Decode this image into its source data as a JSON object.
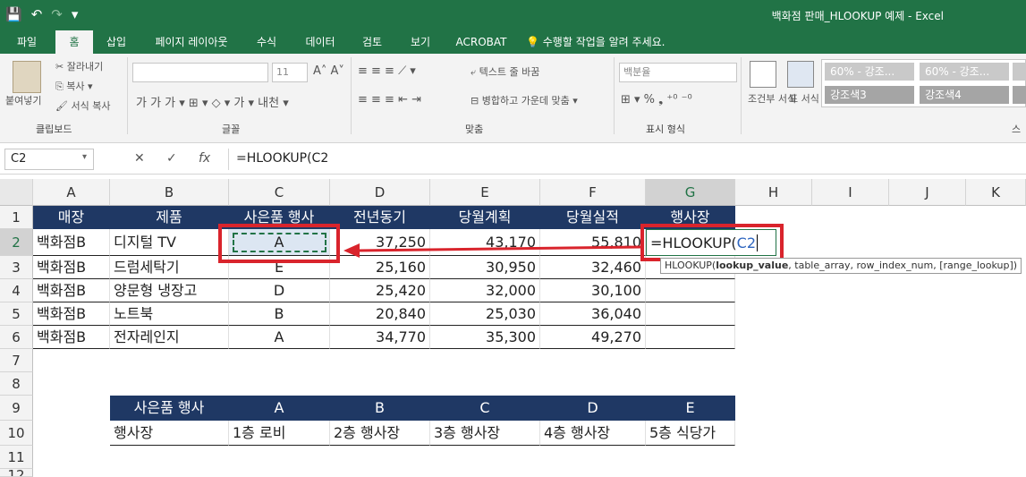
{
  "window": {
    "title": "백화점 판매_HLOOKUP 예제 - Excel",
    "qat": {
      "save": "💾",
      "undo": "↶",
      "redo": "↷",
      "more": "▾"
    }
  },
  "tabs": [
    "파일",
    "홈",
    "삽입",
    "페이지 레이아웃",
    "수식",
    "데이터",
    "검토",
    "보기",
    "ACROBAT"
  ],
  "tell_me": "수행할 작업을 알려 주세요.",
  "ribbon": {
    "clipboard": {
      "label": "클립보드",
      "paste": "붙여넣기",
      "cut": "잘라내기",
      "copy": "복사",
      "format_painter": "서식 복사"
    },
    "font": {
      "label": "글꼴",
      "size": "11"
    },
    "alignment": {
      "label": "맞춤",
      "wrap": "텍스트 줄 바꿈",
      "merge": "병합하고 가운데 맞춤"
    },
    "number": {
      "label": "표시 형식",
      "format": "백분율"
    },
    "styles": {
      "cond": "조건부 서식",
      "table": "표 서식",
      "chips": [
        "60% - 강조...",
        "60% - 강조...",
        "강조색3",
        "강조색4"
      ],
      "label": "스"
    }
  },
  "formula_bar": {
    "name_box": "C2",
    "cancel": "✕",
    "enter": "✓",
    "fx": "fx",
    "formula": "=HLOOKUP(C2"
  },
  "columns": [
    "A",
    "B",
    "C",
    "D",
    "E",
    "F",
    "G",
    "H",
    "I",
    "J",
    "K"
  ],
  "rows": [
    "1",
    "2",
    "3",
    "4",
    "5",
    "6",
    "7",
    "8",
    "9",
    "10",
    "11",
    "12"
  ],
  "header": [
    "매장",
    "제품",
    "사은품 행사",
    "전년동기",
    "당월계획",
    "당월실적",
    "행사장"
  ],
  "data": [
    [
      "백화점B",
      "디지털 TV",
      "A",
      "37,250",
      "43,170",
      "55,810"
    ],
    [
      "백화점B",
      "드럼세탁기",
      "E",
      "25,160",
      "30,950",
      "32,460"
    ],
    [
      "백화점B",
      "양문형 냉장고",
      "D",
      "25,420",
      "32,000",
      "30,100"
    ],
    [
      "백화점B",
      "노트북",
      "B",
      "20,840",
      "25,030",
      "36,040"
    ],
    [
      "백화점B",
      "전자레인지",
      "A",
      "34,770",
      "35,300",
      "49,270"
    ]
  ],
  "edit_cell": {
    "prefix": "=HLOOKUP(",
    "ref": "C2"
  },
  "tooltip": {
    "fn": "HLOOKUP(",
    "arg1": "lookup_value",
    "rest": ", table_array, row_index_num, [range_lookup])"
  },
  "lookup": {
    "row9": [
      "사은품 행사",
      "A",
      "B",
      "C",
      "D",
      "E"
    ],
    "row10": [
      "행사장",
      "1층 로비",
      "2층 행사장",
      "3층 행사장",
      "4층 행사장",
      "5층 식당가"
    ]
  }
}
